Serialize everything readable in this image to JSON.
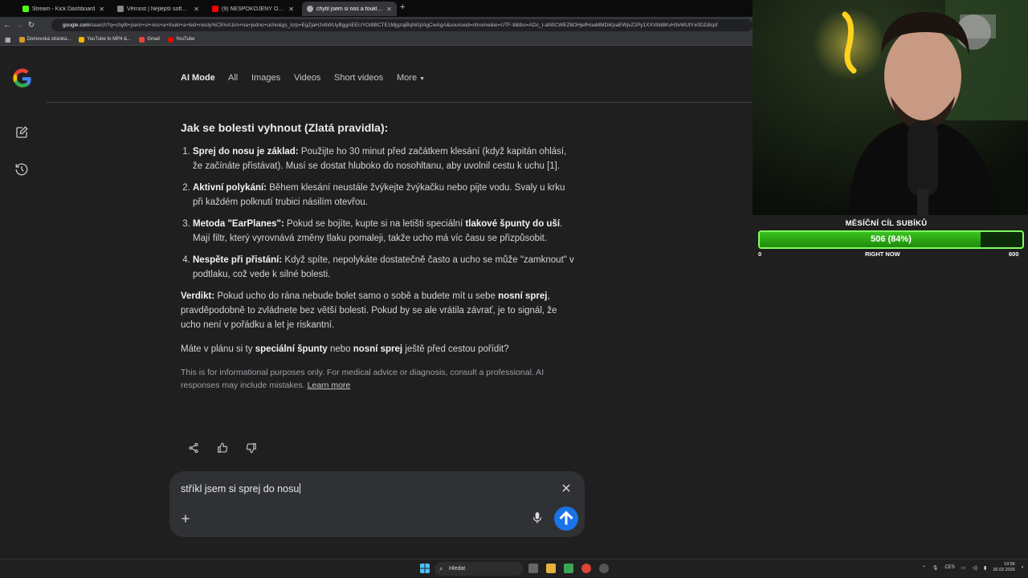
{
  "tabs": [
    {
      "title": "Stream - Kick Dashboard",
      "color": "#53fc18"
    },
    {
      "title": "Věrnost | Nejlepší software pro",
      "color": "#555"
    },
    {
      "title": "(9) NESPOKOJENÝ OBČAN DOKON",
      "color": "#ff0000"
    },
    {
      "title": "chytil jsem si nos a foukl a...",
      "color": "#aaa"
    }
  ],
  "address": {
    "domain": "google.com",
    "path": "/search?q=chytil+jsem+si+nos+a+foukl+a+ted+nesly%C5%A1im+na+jedno+ucho&gs_lcrp=EgZjaHJvbWUyBggAEEUYOdIBCTE1MjgzajBqNGjIAgCwAgA&sourceid=chrome&ie=UTF-8&tbs=ADc_I-aN0CWEZ8OHjefHoaMMDiKpaEWjvZ2Py1XXV8d8KvH3vWUtYx0DZdlcpf"
  },
  "bookmarks": [
    "Domovská stránka...",
    "YouTube to MP4 &...",
    "Gmail",
    "YouTube"
  ],
  "search_tabs": [
    "AI Mode",
    "All",
    "Images",
    "Videos",
    "Short videos",
    "More"
  ],
  "answer": {
    "heading": "Jak se bolesti vyhnout (Zlatá pravidla):",
    "items": [
      {
        "bold": "Sprej do nosu je základ:",
        "text": " Použijte ho 30 minut před začátkem klesání (když kapitán ohlásí, že začínáte přistávat). Musí se dostat hluboko do nosohltanu, aby uvolnil cestu k uchu [1]."
      },
      {
        "bold": "Aktivní polykání:",
        "text": " Během klesání neustále žvýkejte žvýkačku nebo pijte vodu. Svaly u krku při každém polknutí trubici násilím otevřou."
      },
      {
        "bold": "Metoda \"EarPlanes\":",
        "text": " Pokud se bojíte, kupte si na letišti speciální ",
        "bold2": "tlakové špunty do uší",
        "text2": ". Mají filtr, který vyrovnává změny tlaku pomaleji, takže ucho má víc času se přizpůsobit."
      },
      {
        "bold": "Nespěte při přistání:",
        "text": " Když spíte, nepolykáte dostatečně často a ucho se může \"zamknout\" v podtlaku, což vede k silné bolesti."
      }
    ],
    "verdict_label": "Verdikt:",
    "verdict_a": " Pokud ucho do rána nebude bolet samo o sobě a budete mít u sebe ",
    "verdict_b": "nosní sprej",
    "verdict_c": ", pravděpodobně to zvládnete bez větší bolesti. Pokud by se ale vrátila závrať, je to signál, že ucho není v pořádku a let je riskantní.",
    "q_a": "Máte v plánu si ty ",
    "q_b": "speciální špunty",
    "q_c": " nebo ",
    "q_d": "nosní sprej",
    "q_e": " ještě před cestou pořídit?",
    "disclaimer": "This is for informational purposes only. For medical advice or diagnosis, consult a professional. AI responses may include mistakes. ",
    "learn_more": "Learn more"
  },
  "input": {
    "value": "stříkl jsem si sprej do nosu"
  },
  "overlay": {
    "title": "MĚSÍČNÍ CÍL SUBÍKŮ",
    "value_text": "506 (84%)",
    "progress": 0.84,
    "min": "0",
    "center": "RIGHT NOW",
    "max": "600"
  },
  "taskbar": {
    "search": "Hledat",
    "lang": "CES",
    "time": "19:56",
    "date": "26.02.2026"
  }
}
